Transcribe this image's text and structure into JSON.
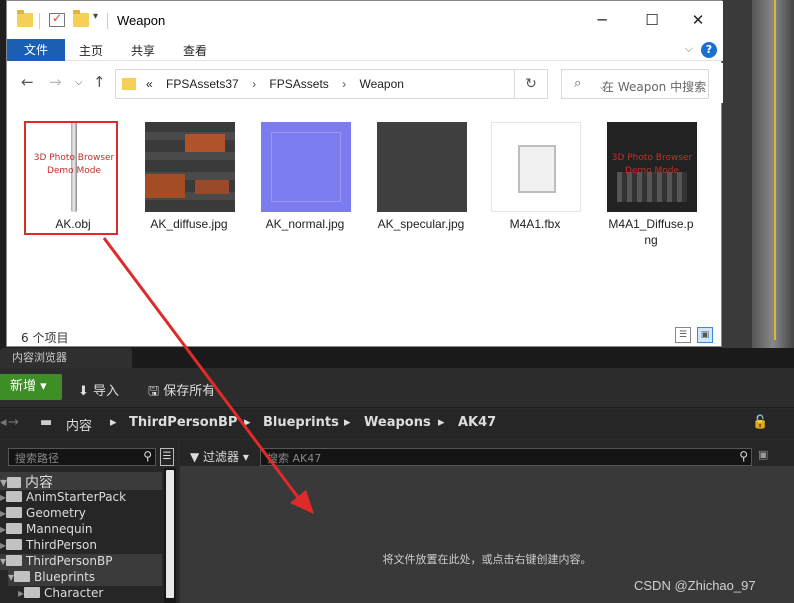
{
  "explorer": {
    "title": "Weapon",
    "ribbon": {
      "file": "文件",
      "home": "主页",
      "share": "共享",
      "view": "查看"
    },
    "path": [
      "FPSAssets37",
      "FPSAssets",
      "Weapon"
    ],
    "path_prefix": "«",
    "search_placeholder": "在 Weapon 中搜索",
    "files": [
      {
        "name": "AK.obj",
        "line2": ""
      },
      {
        "name": "AK_diffuse.jpg",
        "line2": ""
      },
      {
        "name": "AK_normal.jpg",
        "line2": ""
      },
      {
        "name": "AK_specular.jpg",
        "line2": ""
      },
      {
        "name": "M4A1.fbx",
        "line2": ""
      },
      {
        "name": "M4A1_Diffuse.p",
        "line2": "ng"
      }
    ],
    "demo_text": "3D Photo Browser\nDemo Mode",
    "status": "6 个项目"
  },
  "unreal": {
    "tab": "内容浏览器",
    "toolbar": {
      "new": "新增",
      "import": "导入",
      "save_all": "保存所有"
    },
    "path": [
      "内容",
      "ThirdPersonBP",
      "Blueprints",
      "Weapons",
      "AK47"
    ],
    "search_paths_placeholder": "搜索路径",
    "filter": "过滤器",
    "search_placeholder": "搜索 AK47",
    "tree": {
      "root": "内容",
      "items": [
        "AnimStarterPack",
        "Geometry",
        "Mannequin",
        "ThirdPerson",
        "ThirdPersonBP",
        "Blueprints",
        "Character"
      ]
    },
    "drop_message": "将文件放置在此处，或点击右键创建内容。"
  },
  "watermark": "CSDN @Zhichao_97",
  "colors": {
    "accent_blue": "#1a5fb4",
    "ue_green": "#3e8e25",
    "annotation_red": "#e02a2a"
  }
}
